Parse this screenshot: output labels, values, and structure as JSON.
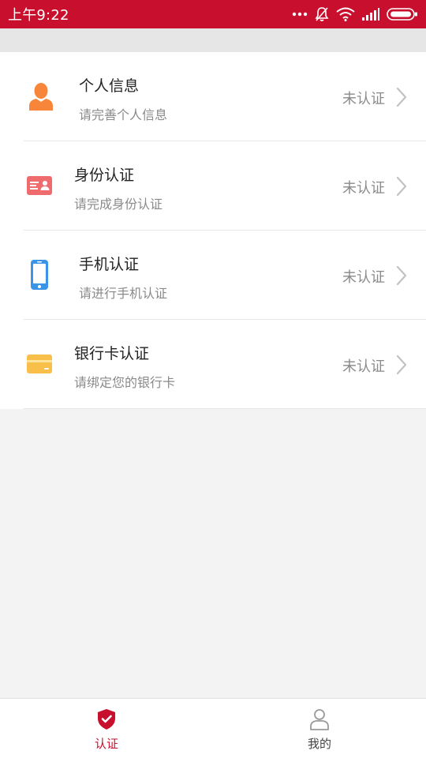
{
  "status_bar": {
    "time": "上午9:22",
    "icons": [
      "more-icon",
      "mute-icon",
      "wifi-icon",
      "signal-icon",
      "battery-icon"
    ]
  },
  "colors": {
    "brand_red": "#c8102e",
    "orange": "#f7863a",
    "card_red": "#ee6b6e",
    "phone_blue": "#3b95e6",
    "bank_yellow": "#f8c04a"
  },
  "items": [
    {
      "icon": "person-icon",
      "title": "个人信息",
      "subtitle": "请完善个人信息",
      "status": "未认证"
    },
    {
      "icon": "id-card-icon",
      "title": "身份认证",
      "subtitle": "请完成身份认证",
      "status": "未认证"
    },
    {
      "icon": "phone-icon",
      "title": "手机认证",
      "subtitle": "请进行手机认证",
      "status": "未认证"
    },
    {
      "icon": "bank-card-icon",
      "title": "银行卡认证",
      "subtitle": "请绑定您的银行卡",
      "status": "未认证"
    }
  ],
  "tabs": [
    {
      "icon": "shield-check-icon",
      "label": "认证",
      "active": true
    },
    {
      "icon": "user-icon",
      "label": "我的",
      "active": false
    }
  ]
}
